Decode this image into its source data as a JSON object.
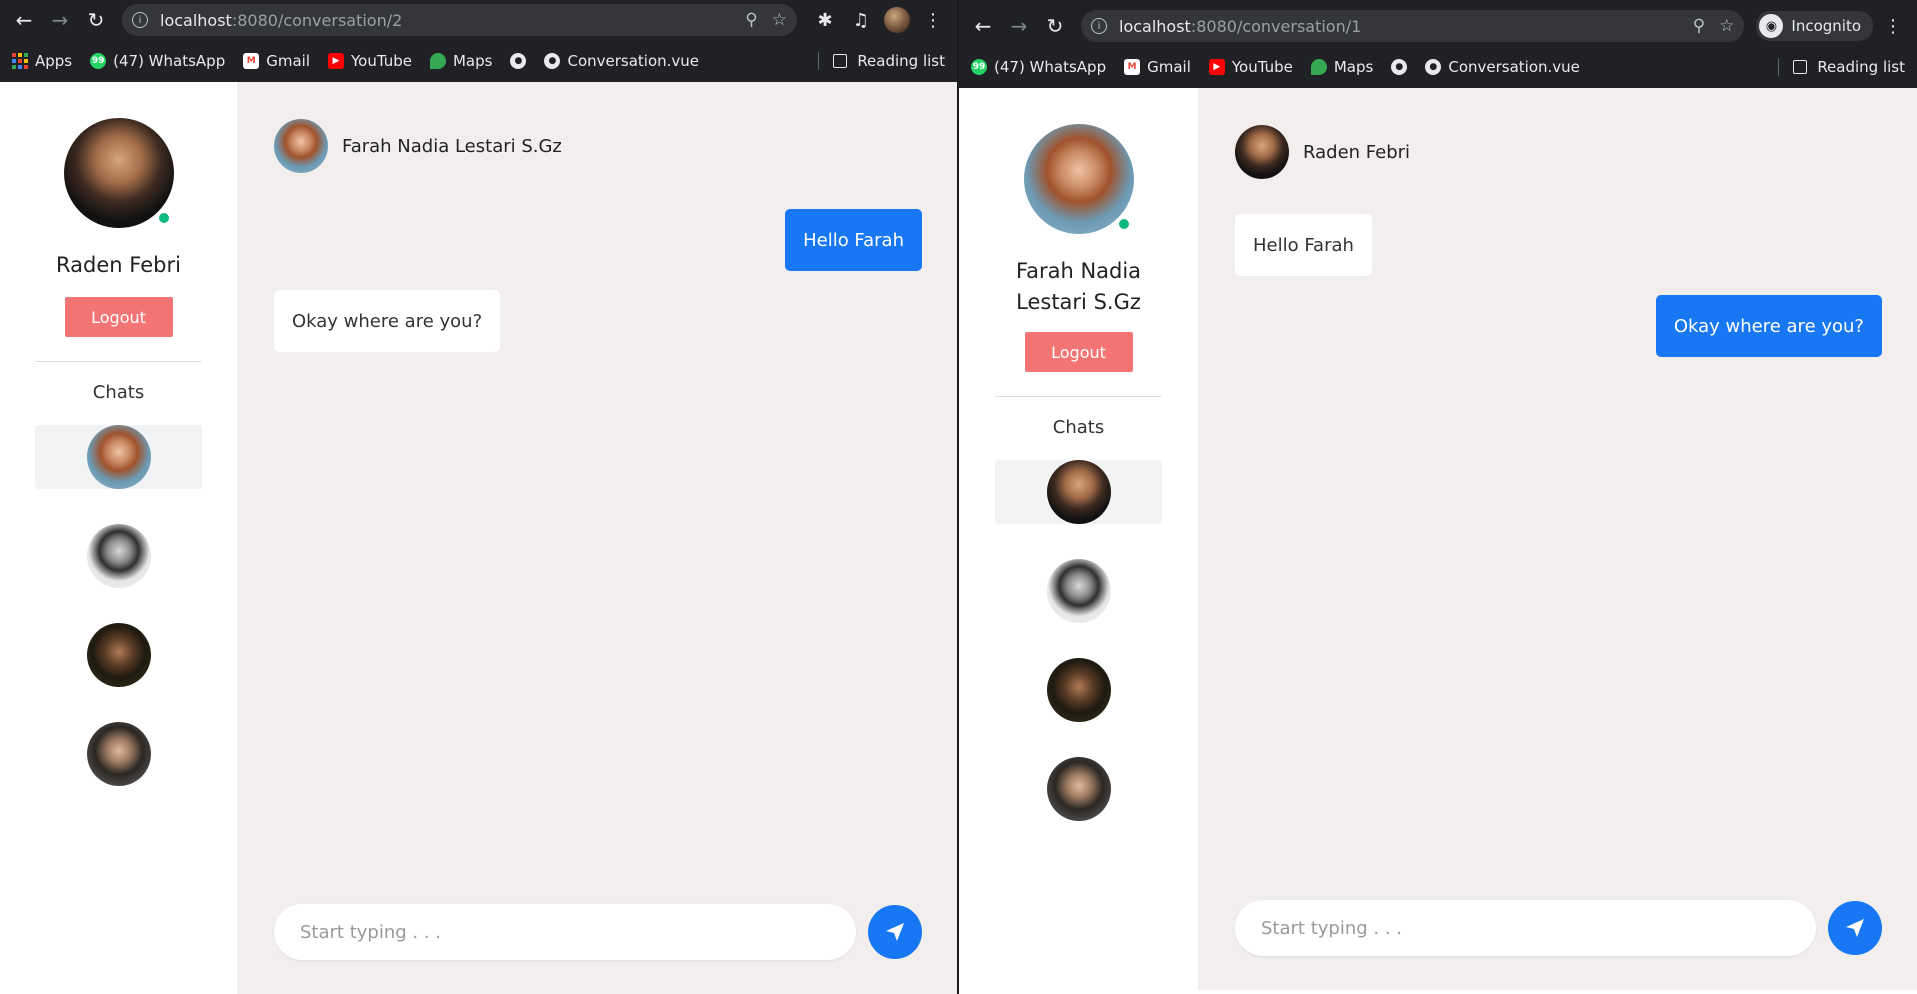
{
  "bookmarks_common": {
    "whatsapp": "(47) WhatsApp",
    "gmail": "Gmail",
    "youtube": "YouTube",
    "maps": "Maps",
    "conversation": "Conversation.vue",
    "reading_list": "Reading list"
  },
  "left": {
    "url_host": "localhost",
    "url_path": ":8080/conversation/2",
    "apps_label": "Apps",
    "user_name": "Raden Febri",
    "logout_label": "Logout",
    "chats_title": "Chats",
    "header_name": "Farah Nadia Lestari S.Gz",
    "messages": [
      {
        "text": "Hello Farah",
        "direction": "out"
      },
      {
        "text": "Okay where are you?",
        "direction": "in"
      }
    ],
    "placeholder": "Start typing . . ."
  },
  "right": {
    "url_host": "localhost",
    "url_path": ":8080/conversation/1",
    "incognito_label": "Incognito",
    "user_name": "Farah Nadia Lestari S.Gz",
    "logout_label": "Logout",
    "chats_title": "Chats",
    "header_name": "Raden Febri",
    "messages": [
      {
        "text": "Hello Farah",
        "direction": "in"
      },
      {
        "text": "Okay where are you?",
        "direction": "out"
      }
    ],
    "placeholder": "Start typing . . ."
  },
  "colors": {
    "accent": "#1877f2",
    "logout": "#f27474",
    "online": "#10b981",
    "chat_bg": "#f2eeee"
  }
}
